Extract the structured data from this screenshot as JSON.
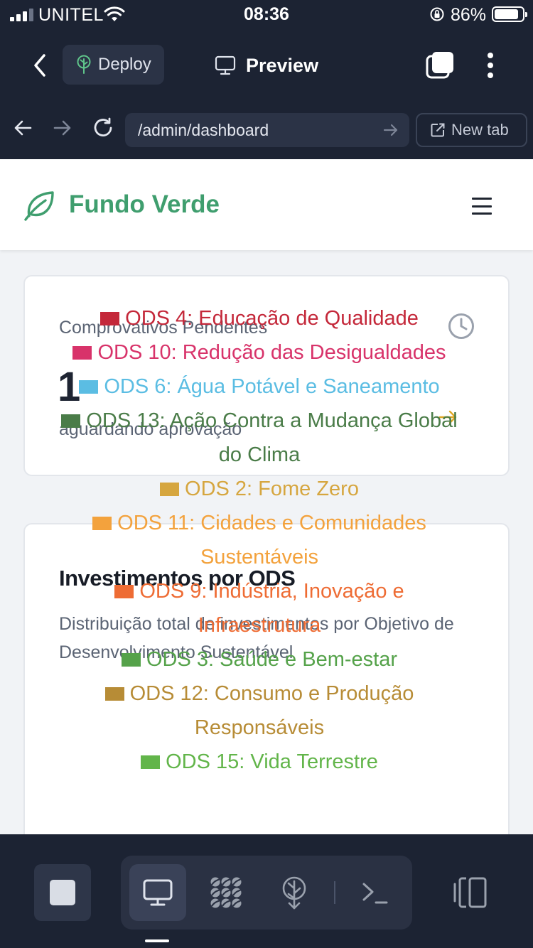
{
  "status_bar": {
    "carrier": "UNITEL",
    "time": "08:36",
    "battery_percent": "86%",
    "battery_level": 0.86,
    "icons": [
      "signal-icon",
      "wifi-icon",
      "orientation-lock-icon",
      "battery-icon"
    ]
  },
  "app_header": {
    "back_icon": "chevron-left-icon",
    "deploy_label": "Deploy",
    "deploy_icon": "deploy-tree-icon",
    "preview_label": "Preview",
    "preview_icon": "monitor-icon",
    "tabs_icon": "tabs-icon",
    "more_icon": "more-vertical-icon"
  },
  "browser_bar": {
    "url": "/admin/dashboard",
    "new_tab_label": "New tab",
    "icons": [
      "arrow-left-icon",
      "arrow-right-icon",
      "reload-icon",
      "go-arrow-icon",
      "external-link-icon"
    ]
  },
  "site": {
    "name": "Fundo Verde",
    "brand_color": "#3f9e6e",
    "logo_icon": "leaf-icon",
    "menu_icon": "hamburger-icon"
  },
  "pending_card": {
    "title": "Comprovativos Pendentes",
    "count": "1",
    "subtitle": "aguardando aprovação",
    "icon": "clock-icon",
    "action_icon": "arrow-right-icon",
    "action_color": "#e0a826"
  },
  "ods_card": {
    "title": "Investimentos por ODS",
    "description": "Distribuição total de investimentos por Objetivo de Desenvolvimento Sustentável",
    "legend": [
      {
        "label": "ODS 4: Educação de Qualidade",
        "color": "#c4283a"
      },
      {
        "label": "ODS 10: Redução das Desigualdades",
        "color": "#d8336a"
      },
      {
        "label": "ODS 6: Água Potável e Saneamento",
        "color": "#5bbde3"
      },
      {
        "label": "ODS 13: Ação Contra a Mudança Global do Clima",
        "color": "#4a7c48"
      },
      {
        "label": "ODS 2: Fome Zero",
        "color": "#d6a63f"
      },
      {
        "label": "ODS 11: Cidades e Comunidades Sustentáveis",
        "color": "#f3a23d"
      },
      {
        "label": "ODS 9: Indústria, Inovação e Infraestrutura",
        "color": "#ee6c34"
      },
      {
        "label": "ODS 3: Saúde e Bem-estar",
        "color": "#55a24a"
      },
      {
        "label": "ODS 12: Consumo e Produção Responsáveis",
        "color": "#b78c36"
      },
      {
        "label": "ODS 15: Vida Terrestre",
        "color": "#62b54a"
      }
    ]
  },
  "bottom_bar": {
    "stop_icon": "stop-icon",
    "tools": [
      {
        "name": "preview-tool",
        "icon": "monitor-icon",
        "active": true
      },
      {
        "name": "apps-tool",
        "icon": "grid-blobs-icon",
        "active": false
      },
      {
        "name": "deploy-tool",
        "icon": "deploy-tree-icon",
        "active": false
      },
      {
        "name": "shell-tool",
        "icon": "terminal-icon",
        "active": false
      }
    ],
    "panel_icon": "panels-icon"
  }
}
